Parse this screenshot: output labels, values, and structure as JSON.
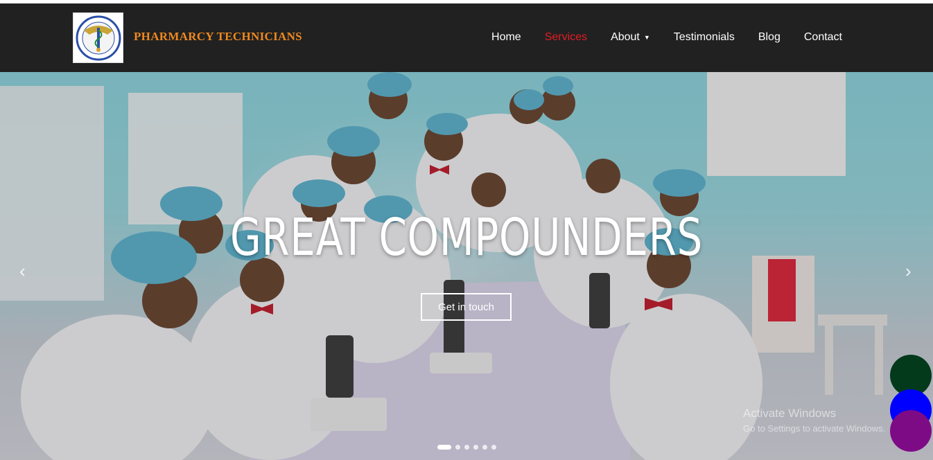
{
  "brand": {
    "name": "PHARMARCY TECHNICIANS",
    "logo_icon": "college-crest-logo"
  },
  "nav": {
    "items": [
      {
        "label": "Home",
        "active": false
      },
      {
        "label": "Services",
        "active": true
      },
      {
        "label": "About",
        "has_dropdown": true
      },
      {
        "label": "Testimonials",
        "active": false
      },
      {
        "label": "Blog",
        "active": false
      },
      {
        "label": "Contact",
        "active": false
      }
    ],
    "active_color": "#e31e24"
  },
  "hero": {
    "title": "GREAT COMPOUNDERS",
    "cta_label": "Get in touch",
    "slides_total": 6,
    "current_slide": 1,
    "prev_icon": "chevron-left-icon",
    "next_icon": "chevron-right-icon"
  },
  "watermark": {
    "title": "Activate Windows",
    "subtitle": "Go to Settings to activate Windows."
  },
  "floating_buttons": [
    {
      "name": "whatsapp",
      "color": "#033a1c"
    },
    {
      "name": "facebook",
      "color": "#0000ff"
    },
    {
      "name": "instagram",
      "color": "#7e0b86"
    }
  ]
}
